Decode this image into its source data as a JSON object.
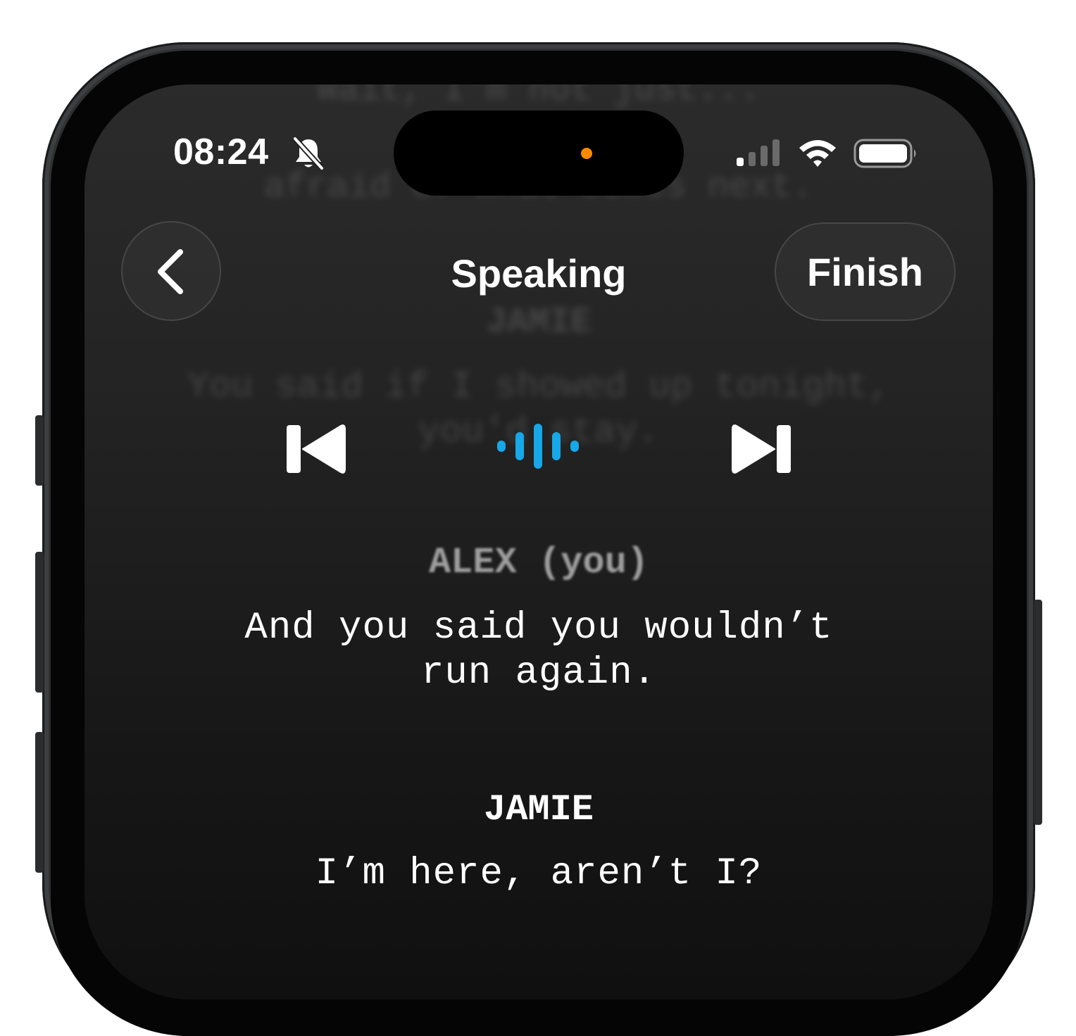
{
  "status_bar": {
    "time": "08:24",
    "icons": [
      "bell-slash-icon",
      "cellular-signal-icon",
      "wifi-icon",
      "battery-icon"
    ]
  },
  "nav": {
    "back_icon": "chevron-left-icon",
    "title": "Speaking",
    "finish_label": "Finish"
  },
  "background_script": {
    "line_a": "Wait, I'm not just...",
    "line_b": "afraid of what comes next.",
    "speaker": "JAMIE",
    "line_c": "You said if I showed up tonight,",
    "line_d": "you'd stay."
  },
  "controls": {
    "previous_icon": "skip-back-icon",
    "listening_icon": "waveform-icon",
    "next_icon": "skip-forward-icon",
    "accent_color": "#16a8e8"
  },
  "script": {
    "current_speaker": "ALEX (you)",
    "current_line_1": "And you said you wouldn’t",
    "current_line_2": "run again.",
    "next_speaker": "JAMIE",
    "next_line": "I’m here, aren’t I?"
  }
}
